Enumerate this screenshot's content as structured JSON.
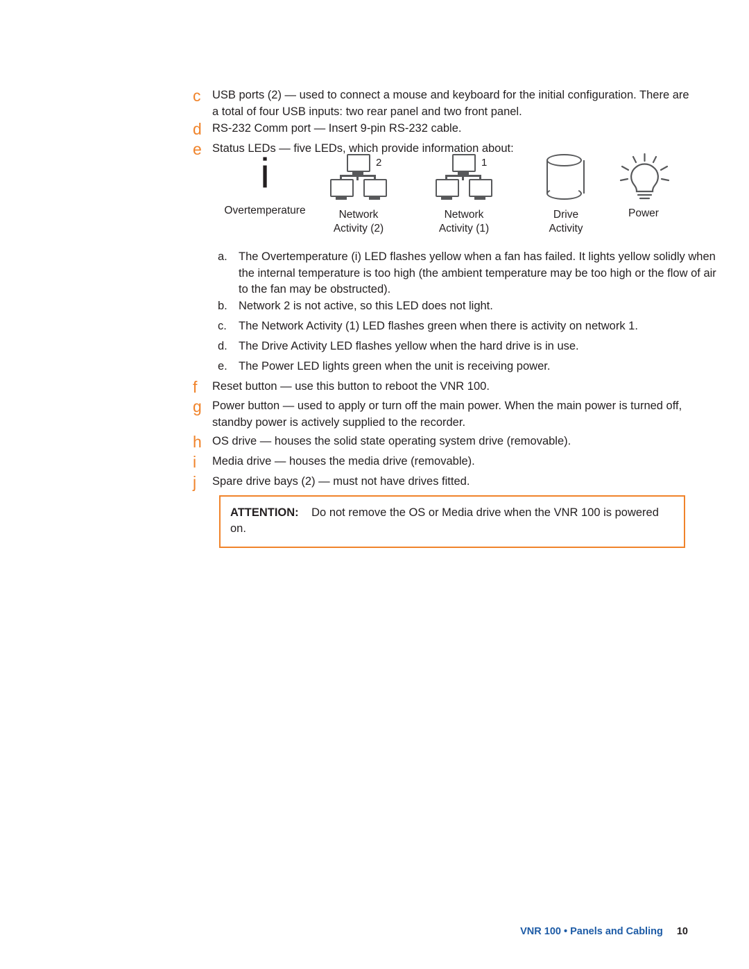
{
  "document": {
    "items": [
      {
        "marker": "c",
        "lead": "USB ports (2)",
        "text": "USB ports (2) — used to connect a mouse and keyboard for the initial configuration. There are a total of four USB inputs: two rear panel and two front panel."
      },
      {
        "marker": "d",
        "lead": "RS-232 Comm port",
        "text": "RS-232 Comm port — Insert 9-pin RS-232 cable."
      },
      {
        "marker": "e",
        "lead": "Status LEDs",
        "text": "Status LEDs — five LEDs, which provide information about:"
      },
      {
        "marker": "f",
        "lead": "Reset button",
        "text": "Reset button — use this button to reboot the VNR 100."
      },
      {
        "marker": "g",
        "lead": "Power button",
        "text": "Power button — used to apply or turn off the main power. When the main power is turned off, standby power is actively supplied to the recorder."
      },
      {
        "marker": "h",
        "lead": "OS drive",
        "text": "OS drive — houses the solid state operating system drive (removable)."
      },
      {
        "marker": "i",
        "lead": "Media drive",
        "text": "Media drive — houses the media drive (removable)."
      },
      {
        "marker": "j",
        "lead": "Spare drive bays (2)",
        "text": "Spare drive bays (2) — must not have drives fitted."
      }
    ],
    "leds": [
      {
        "icon": "overtemperature-icon",
        "label_line1": "Overtemperature",
        "label_line2": "",
        "badge": ""
      },
      {
        "icon": "network-activity-2-icon",
        "label_line1": "Network",
        "label_line2": "Activity (2)",
        "badge": "2"
      },
      {
        "icon": "network-activity-1-icon",
        "label_line1": "Network",
        "label_line2": "Activity (1)",
        "badge": "1"
      },
      {
        "icon": "drive-activity-icon",
        "label_line1": "Drive",
        "label_line2": "Activity",
        "badge": ""
      },
      {
        "icon": "power-icon",
        "label_line1": "Power",
        "label_line2": "",
        "badge": ""
      }
    ],
    "sub_items": [
      {
        "marker": "a.",
        "text": "The Overtemperature (i) LED flashes yellow when a fan has failed. It lights yellow solidly when the internal temperature is too high (the ambient temperature may be too high or the flow of air to the fan may be obstructed)."
      },
      {
        "marker": "b.",
        "text": "Network 2 is not active, so this LED does not light."
      },
      {
        "marker": "c.",
        "text": "The Network Activity (1) LED flashes green when there is activity on network 1."
      },
      {
        "marker": "d.",
        "text": "The Drive Activity LED flashes yellow when the hard drive is in use."
      },
      {
        "marker": "e.",
        "text": "The Power LED lights green when the unit is receiving power."
      }
    ],
    "attention": {
      "label": "ATTENTION:",
      "text": "Do not remove the OS or Media drive when the VNR 100 is powered on."
    },
    "footer": {
      "title": "VNR 100 • Panels and Cabling",
      "page": "10"
    },
    "colors": {
      "marker": "#F0832A",
      "attention_border": "#F0832A",
      "footer_link": "#1D5BA6",
      "text": "#231F20"
    }
  }
}
